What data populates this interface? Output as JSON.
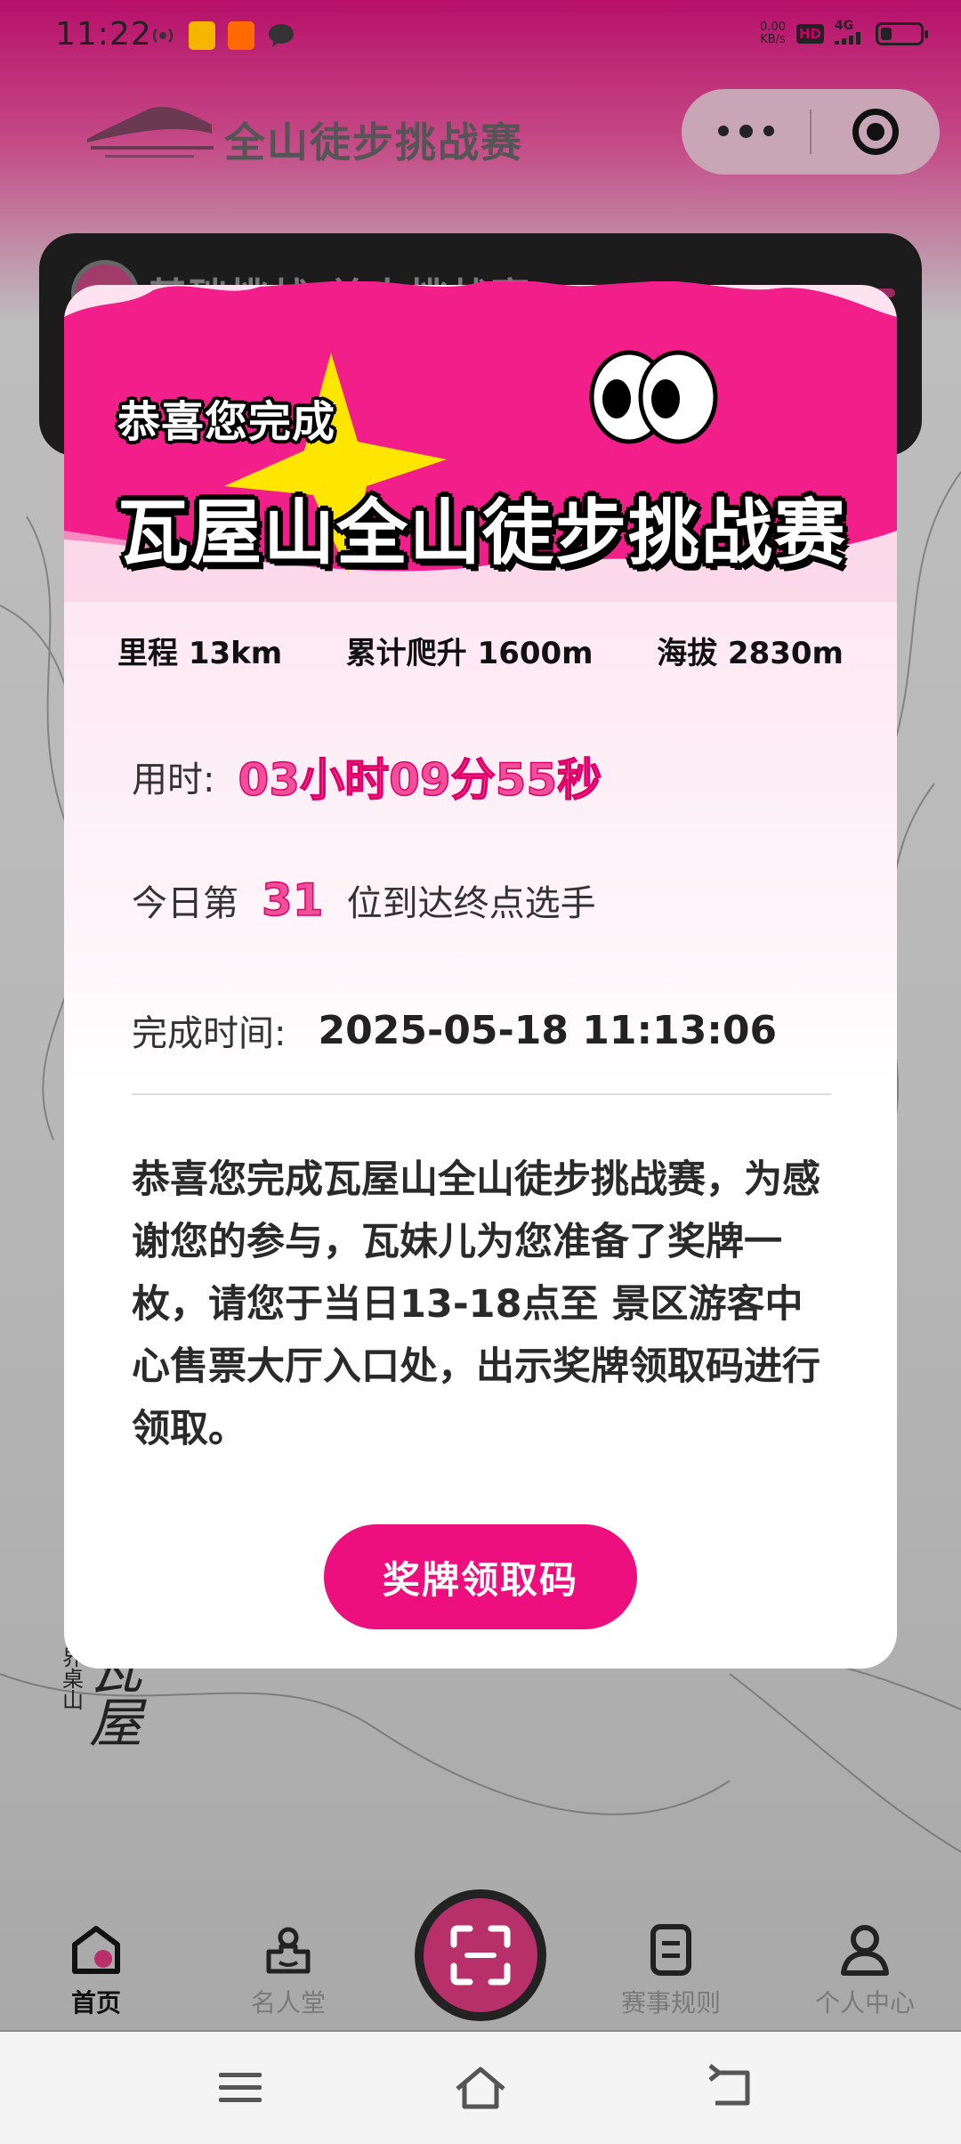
{
  "status_bar": {
    "time": "11:22",
    "net_speed_value": "0.00",
    "net_speed_unit": "KB/s",
    "hd_label": "HD",
    "network_label": "4G"
  },
  "header": {
    "title": "全山徒步挑战赛"
  },
  "background_card": {
    "text": "基础挑战  单人挑战赛"
  },
  "modal": {
    "subtitle": "恭喜您完成",
    "title": "瓦屋山全山徒步挑战赛",
    "stats": [
      {
        "label": "里程",
        "value": "13km"
      },
      {
        "label": "累计爬升",
        "value": "1600m"
      },
      {
        "label": "海拔",
        "value": "2830m"
      }
    ],
    "duration_label": "用时:",
    "duration_value": "03小时09分55秒",
    "rank_prefix": "今日第",
    "rank_value": "31",
    "rank_suffix": "位到达终点选手",
    "finish_label": "完成时间:",
    "finish_value": "2025-05-18 11:13:06",
    "message": "恭喜您完成瓦屋山全山徒步挑战赛，为感谢您的参与，瓦妹儿为您准备了奖牌一枚，请您于当日13-18点至 景区游客中心售票大厅入口处，出示奖牌领取码进行领取。",
    "button_label": "奖牌领取码"
  },
  "tabbar": {
    "tabs": [
      {
        "label": "首页",
        "icon": "home-icon",
        "active": true
      },
      {
        "label": "名人堂",
        "icon": "podium-icon",
        "active": false
      },
      {
        "label": "赛事规则",
        "icon": "document-icon",
        "active": false
      },
      {
        "label": "个人中心",
        "icon": "user-icon",
        "active": false
      }
    ],
    "center_icon": "scan-icon"
  },
  "colors": {
    "accent": "#ee0f7e",
    "modal_bg_top": "#fde2ef",
    "banner_pink": "#f21f8b",
    "star_yellow": "#ffe600"
  }
}
